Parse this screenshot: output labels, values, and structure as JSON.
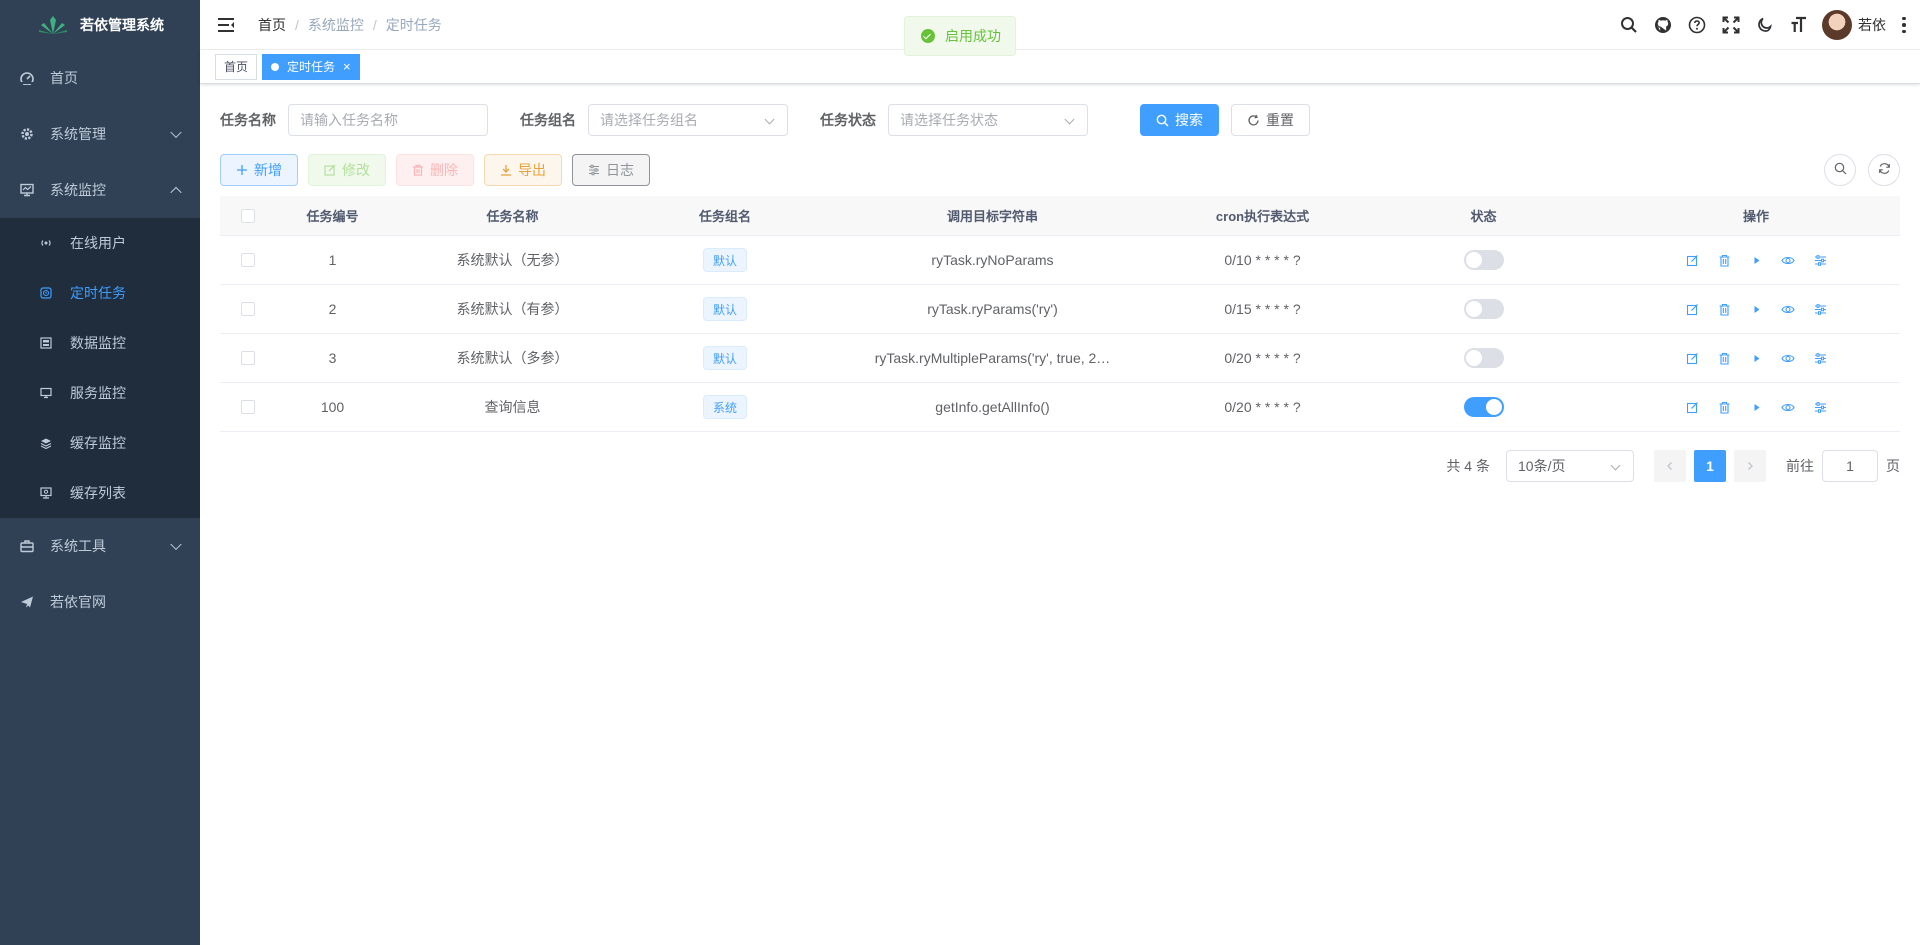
{
  "app": {
    "title": "若依管理系统"
  },
  "sidebar": {
    "items": [
      {
        "label": "首页",
        "icon": "dashboard-icon"
      },
      {
        "label": "系统管理",
        "icon": "gear-icon"
      },
      {
        "label": "系统监控",
        "icon": "monitor-icon"
      },
      {
        "label": "系统工具",
        "icon": "toolbox-icon"
      },
      {
        "label": "若依官网",
        "icon": "paper-plane-icon"
      }
    ],
    "monitor_sub": [
      {
        "label": "在线用户",
        "icon": "online-icon"
      },
      {
        "label": "定时任务",
        "icon": "job-icon"
      },
      {
        "label": "数据监控",
        "icon": "druid-icon"
      },
      {
        "label": "服务监控",
        "icon": "server-icon"
      },
      {
        "label": "缓存监控",
        "icon": "redis-icon"
      },
      {
        "label": "缓存列表",
        "icon": "redis-list-icon"
      }
    ]
  },
  "breadcrumb": [
    "首页",
    "系统监控",
    "定时任务"
  ],
  "header": {
    "user": "若依"
  },
  "tags": [
    {
      "label": "首页"
    },
    {
      "label": "定时任务",
      "close": "×"
    }
  ],
  "toast": {
    "message": "启用成功"
  },
  "search": {
    "name_label": "任务名称",
    "name_placeholder": "请输入任务名称",
    "group_label": "任务组名",
    "group_placeholder": "请选择任务组名",
    "status_label": "任务状态",
    "status_placeholder": "请选择任务状态",
    "search_button": "搜索",
    "reset_button": "重置"
  },
  "toolbar": {
    "add": "新增",
    "edit": "修改",
    "delete": "删除",
    "export": "导出",
    "log": "日志"
  },
  "table": {
    "headers": [
      "任务编号",
      "任务名称",
      "任务组名",
      "调用目标字符串",
      "cron执行表达式",
      "状态",
      "操作"
    ],
    "rows": [
      {
        "id": "1",
        "name": "系统默认（无参）",
        "group": "默认",
        "target": "ryTask.ryNoParams",
        "cron": "0/10 * * * * ?",
        "enabled": false
      },
      {
        "id": "2",
        "name": "系统默认（有参）",
        "group": "默认",
        "target": "ryTask.ryParams('ry')",
        "cron": "0/15 * * * * ?",
        "enabled": false
      },
      {
        "id": "3",
        "name": "系统默认（多参）",
        "group": "默认",
        "target": "ryTask.ryMultipleParams('ry', true, 2…",
        "cron": "0/20 * * * * ?",
        "enabled": false
      },
      {
        "id": "100",
        "name": "查询信息",
        "group": "系统",
        "target": "getInfo.getAllInfo()",
        "cron": "0/20 * * * * ?",
        "enabled": true
      }
    ]
  },
  "pagination": {
    "total": "共 4 条",
    "page_size": "10条/页",
    "current_page": "1",
    "goto_label": "前往",
    "goto_value": "1",
    "page_unit": "页"
  },
  "colors": {
    "primary": "#409eff",
    "sidebar_bg": "#304156",
    "submenu_bg": "#1f2d3d",
    "success": "#67c23a"
  }
}
